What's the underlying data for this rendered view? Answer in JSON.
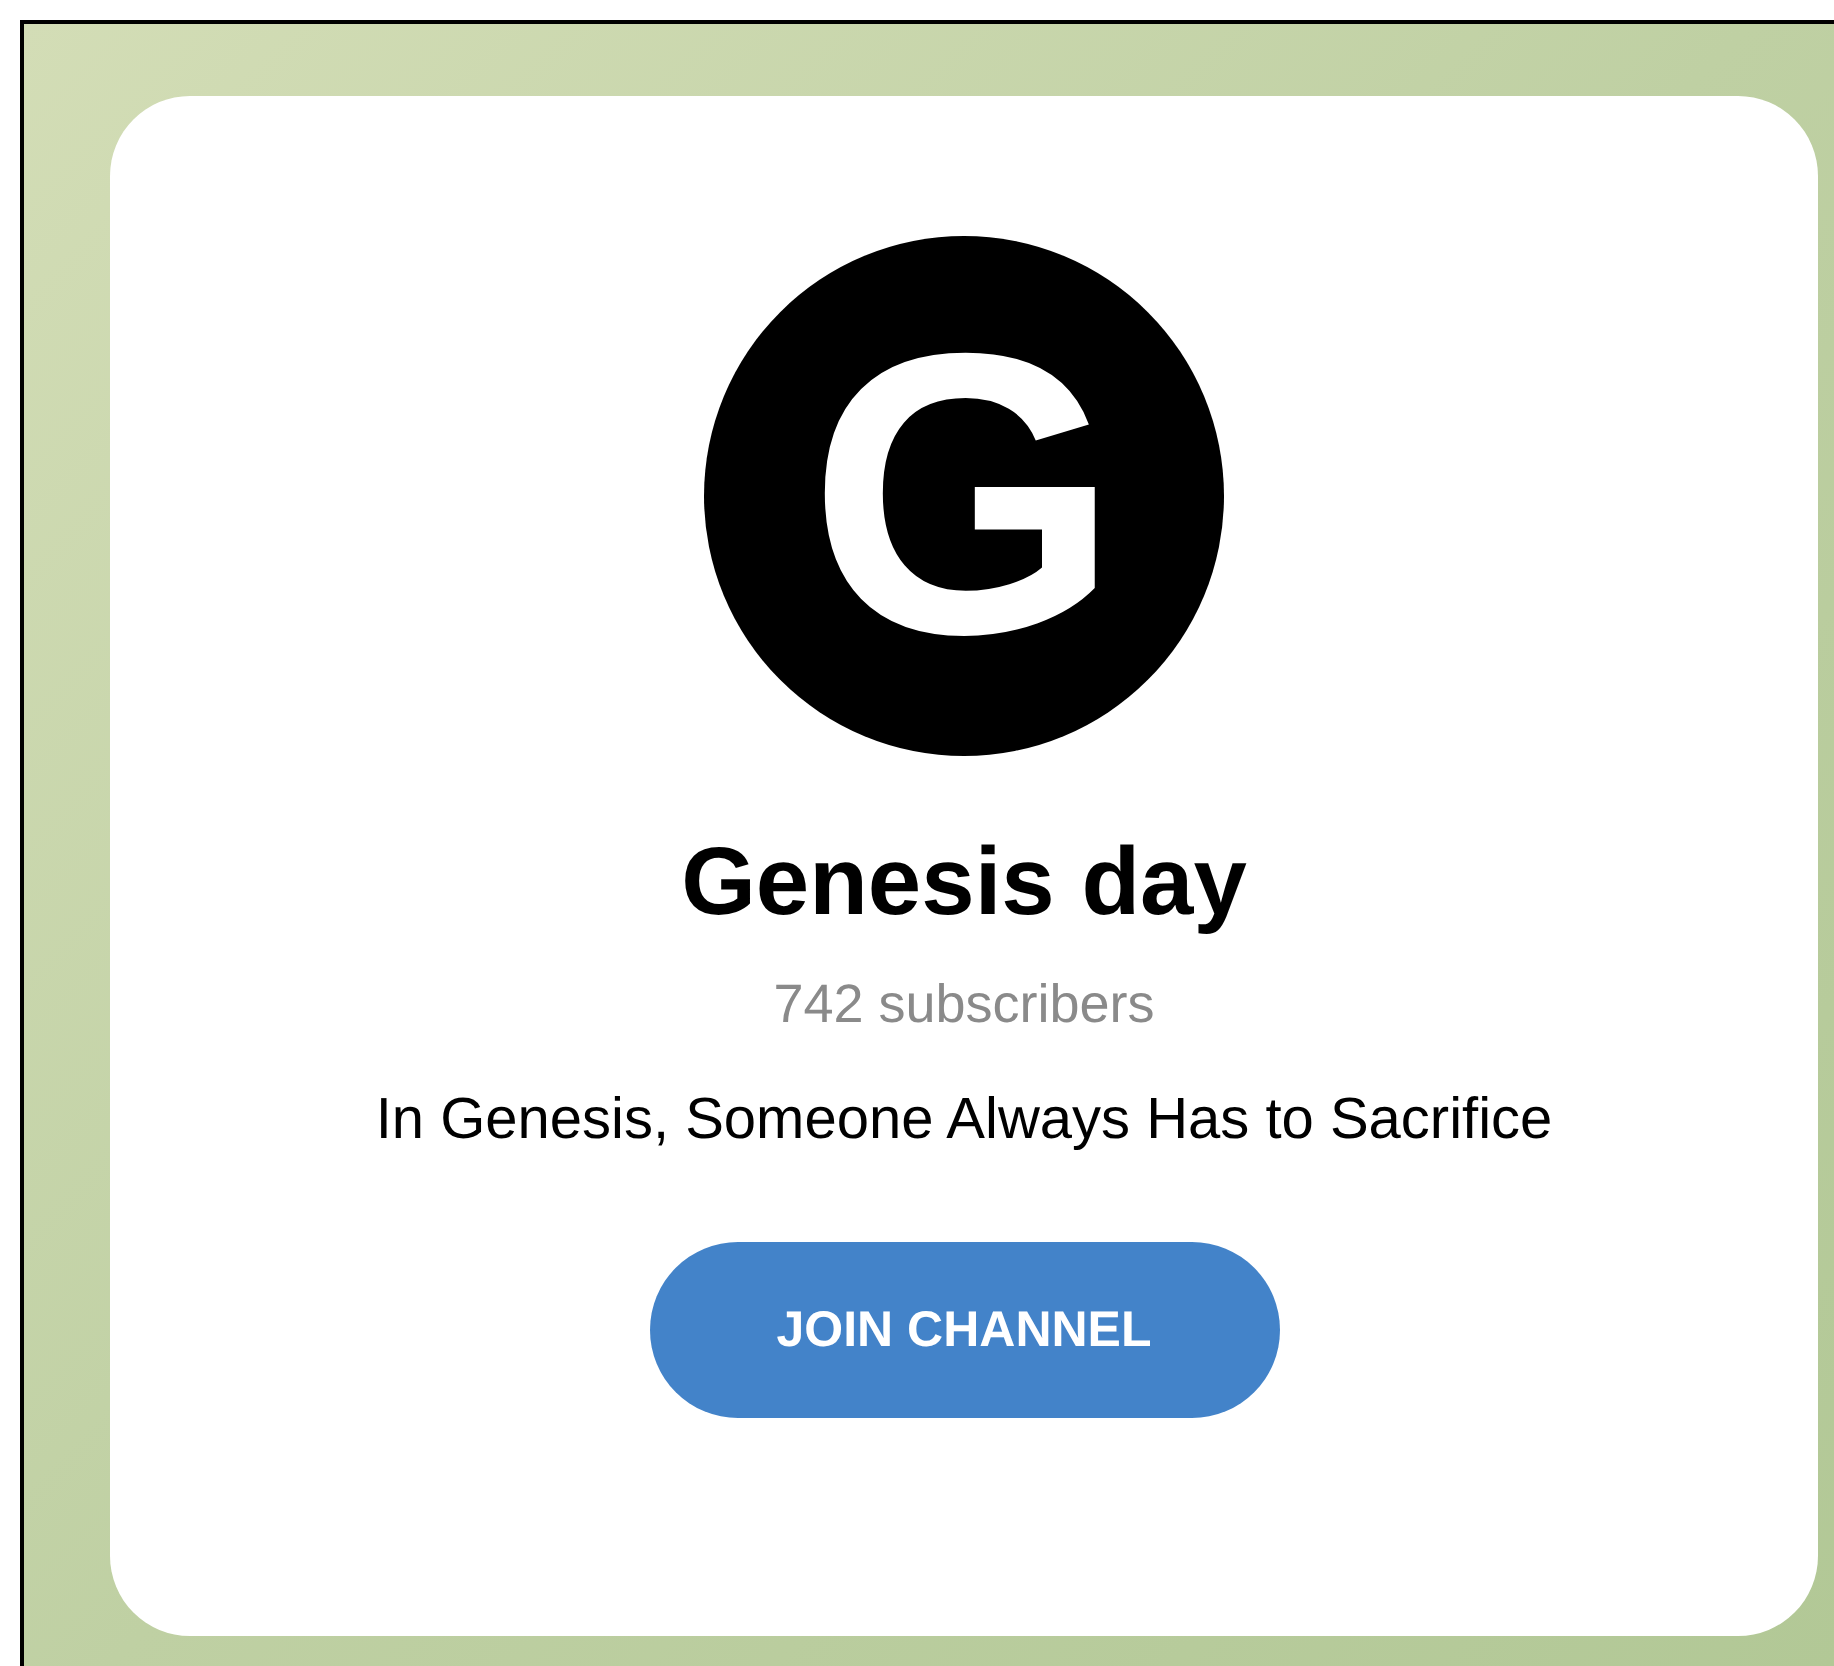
{
  "channel": {
    "logo_letter": "G",
    "title": "Genesis day",
    "subscribers": "742 subscribers",
    "description": "In Genesis, Someone Always Has to Sacrifice"
  },
  "join_button": {
    "label": "JOIN CHANNEL"
  }
}
